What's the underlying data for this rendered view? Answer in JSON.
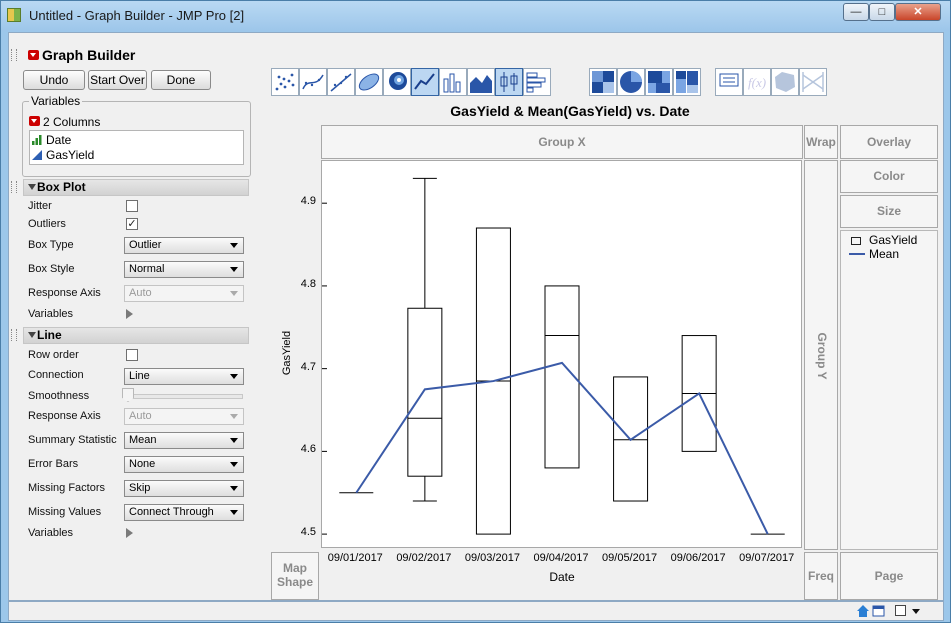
{
  "window": {
    "title": "Untitled - Graph Builder - JMP Pro [2]",
    "minimize_glyph": "—",
    "maximize_glyph": "□",
    "close_glyph": "✕"
  },
  "panel": {
    "title": "Graph Builder",
    "buttons": {
      "undo": "Undo",
      "start_over": "Start Over",
      "done": "Done"
    },
    "variables": {
      "header": "Variables",
      "columns_label": "2 Columns",
      "items": [
        "Date",
        "GasYield"
      ]
    }
  },
  "box_plot": {
    "header": "Box Plot",
    "jitter_label": "Jitter",
    "jitter_checked": false,
    "outliers_label": "Outliers",
    "outliers_checked": true,
    "box_type_label": "Box Type",
    "box_type_value": "Outlier",
    "box_style_label": "Box Style",
    "box_style_value": "Normal",
    "response_axis_label": "Response Axis",
    "response_axis_value": "Auto",
    "variables_label": "Variables"
  },
  "line": {
    "header": "Line",
    "row_order_label": "Row order",
    "row_order_checked": false,
    "connection_label": "Connection",
    "connection_value": "Line",
    "smoothness_label": "Smoothness",
    "response_axis_label": "Response Axis",
    "response_axis_value": "Auto",
    "summary_statistic_label": "Summary Statistic",
    "summary_statistic_value": "Mean",
    "error_bars_label": "Error Bars",
    "error_bars_value": "None",
    "missing_factors_label": "Missing Factors",
    "missing_factors_value": "Skip",
    "missing_values_label": "Missing Values",
    "missing_values_value": "Connect Through",
    "variables_label": "Variables"
  },
  "toolbar_icons": [
    "points-icon",
    "contour-smoother-icon",
    "line-of-fit-icon",
    "ellipse-icon",
    "contour-icon",
    "line-icon",
    "bar-icon",
    "area-icon",
    "box-plot-icon",
    "histogram-icon",
    "heatmap-icon",
    "pie-icon",
    "treemap-icon",
    "mosaic-icon",
    "caption-box-icon",
    "formula-icon",
    "map-shapes-icon",
    "parallel-icon"
  ],
  "drop_zones": {
    "group_x": "Group X",
    "group_y": "Group Y",
    "wrap": "Wrap",
    "overlay": "Overlay",
    "color": "Color",
    "size": "Size",
    "map_shape": "Map Shape",
    "freq": "Freq",
    "page": "Page"
  },
  "legend": {
    "items": [
      {
        "label": "GasYield",
        "kind": "box"
      },
      {
        "label": "Mean",
        "kind": "line",
        "color": "#3b5ba8"
      }
    ]
  },
  "chart_data": {
    "type": "box-line",
    "title": "GasYield & Mean(GasYield) vs. Date",
    "xlabel": "Date",
    "ylabel": "GasYield",
    "categories": [
      "09/01/2017",
      "09/02/2017",
      "09/03/2017",
      "09/04/2017",
      "09/05/2017",
      "09/06/2017",
      "09/07/2017"
    ],
    "y_ticks": [
      4.5,
      4.6,
      4.7,
      4.8,
      4.9
    ],
    "ylim": [
      4.482,
      4.951
    ],
    "boxes": [
      {
        "category": "09/01/2017",
        "min": 4.55,
        "q1": 4.55,
        "median": 4.55,
        "q3": 4.55,
        "max": 4.55
      },
      {
        "category": "09/02/2017",
        "min": 4.54,
        "q1": 4.57,
        "median": 4.64,
        "q3": 4.773,
        "max": 4.93
      },
      {
        "category": "09/03/2017",
        "min": 4.5,
        "q1": 4.5,
        "median": 4.685,
        "q3": 4.87,
        "max": 4.87
      },
      {
        "category": "09/04/2017",
        "min": 4.58,
        "q1": 4.58,
        "median": 4.74,
        "q3": 4.8,
        "max": 4.8
      },
      {
        "category": "09/05/2017",
        "min": 4.54,
        "q1": 4.54,
        "median": 4.614,
        "q3": 4.69,
        "max": 4.69
      },
      {
        "category": "09/06/2017",
        "min": 4.6,
        "q1": 4.6,
        "median": 4.67,
        "q3": 4.74,
        "max": 4.74
      },
      {
        "category": "09/07/2017",
        "min": 4.5,
        "q1": 4.5,
        "median": 4.5,
        "q3": 4.5,
        "max": 4.5
      }
    ],
    "series": [
      {
        "name": "Mean",
        "color": "#3b5ba8",
        "values": [
          4.55,
          4.675,
          4.685,
          4.707,
          4.614,
          4.67,
          4.5
        ]
      }
    ],
    "grid": false
  }
}
